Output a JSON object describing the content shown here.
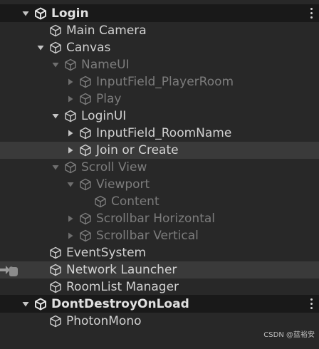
{
  "hierarchy": {
    "rows": [
      {
        "label": "Login",
        "kind": "scene",
        "depth": 0,
        "arrow": "down"
      },
      {
        "label": "Main Camera",
        "kind": "object",
        "depth": 1,
        "arrow": "none"
      },
      {
        "label": "Canvas",
        "kind": "object",
        "depth": 1,
        "arrow": "down"
      },
      {
        "label": "NameUI",
        "kind": "object",
        "depth": 2,
        "arrow": "down",
        "dim": true
      },
      {
        "label": "InputField_PlayerRoom",
        "kind": "object",
        "depth": 3,
        "arrow": "right",
        "dim": true
      },
      {
        "label": "Play",
        "kind": "object",
        "depth": 3,
        "arrow": "right",
        "dim": true
      },
      {
        "label": "LoginUI",
        "kind": "object",
        "depth": 2,
        "arrow": "down"
      },
      {
        "label": "InputField_RoomName",
        "kind": "object",
        "depth": 3,
        "arrow": "right"
      },
      {
        "label": "Join or Create",
        "kind": "object",
        "depth": 3,
        "arrow": "right",
        "highlight": true
      },
      {
        "label": "Scroll View",
        "kind": "object",
        "depth": 2,
        "arrow": "down",
        "dim": true
      },
      {
        "label": "Viewport",
        "kind": "object",
        "depth": 3,
        "arrow": "down",
        "dim": true
      },
      {
        "label": "Content",
        "kind": "object",
        "depth": 4,
        "arrow": "none",
        "dim": true
      },
      {
        "label": "Scrollbar Horizontal",
        "kind": "object",
        "depth": 3,
        "arrow": "right",
        "dim": true
      },
      {
        "label": "Scrollbar Vertical",
        "kind": "object",
        "depth": 3,
        "arrow": "right",
        "dim": true
      },
      {
        "label": "EventSystem",
        "kind": "object",
        "depth": 1,
        "arrow": "none"
      },
      {
        "label": "Network Launcher",
        "kind": "object",
        "depth": 1,
        "arrow": "none",
        "highlight": true,
        "pointer": true
      },
      {
        "label": "RoomList Manager",
        "kind": "object",
        "depth": 1,
        "arrow": "none"
      },
      {
        "label": "DontDestroyOnLoad",
        "kind": "scene",
        "depth": 0,
        "arrow": "down"
      },
      {
        "label": "PhotonMono",
        "kind": "object",
        "depth": 1,
        "arrow": "none"
      }
    ]
  },
  "watermark": "CSDN @蓝裕安",
  "colors": {
    "background": "#282828",
    "scene_row": "#191919",
    "highlight_row": "#3a3a3a",
    "text": "#d2d2d2",
    "dim_text": "#7c7c7c"
  }
}
